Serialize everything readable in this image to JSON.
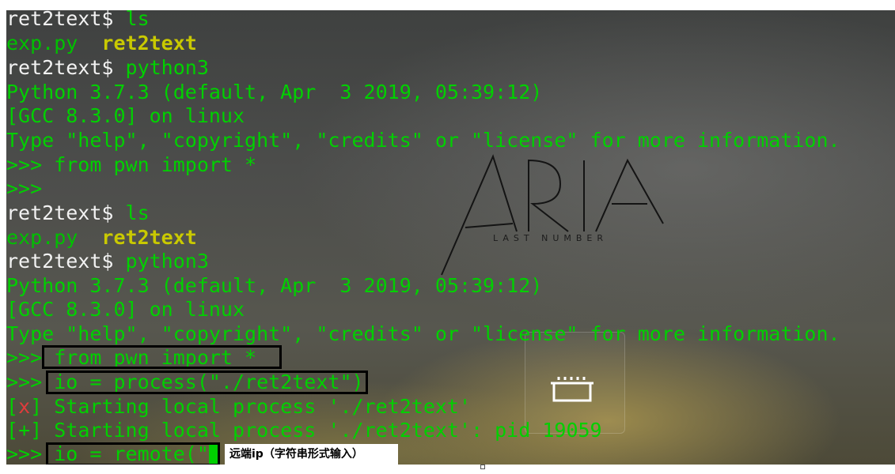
{
  "terminal": {
    "lines": [
      {
        "prompt": "ret2text$ ",
        "cmd": "ls"
      },
      {
        "col1": "exp.py",
        "col2": "ret2text"
      },
      {
        "prompt": "ret2text$ ",
        "cmd": "python3"
      },
      {
        "text": "Python 3.7.3 (default, Apr  3 2019, 05:39:12)"
      },
      {
        "text": "[GCC 8.3.0] on linux"
      },
      {
        "text": "Type \"help\", \"copyright\", \"credits\" or \"license\" for more information."
      },
      {
        "text": ">>> from pwn import *"
      },
      {
        "text": ">>>"
      },
      {
        "prompt": "ret2text$ ",
        "cmd": "ls"
      },
      {
        "col1": "exp.py",
        "col2": "ret2text"
      },
      {
        "prompt": "ret2text$ ",
        "cmd": "python3"
      },
      {
        "text": "Python 3.7.3 (default, Apr  3 2019, 05:39:12)"
      },
      {
        "text": "[GCC 8.3.0] on linux"
      },
      {
        "text": "Type \"help\", \"copyright\", \"credits\" or \"license\" for more information."
      },
      {
        "pyprompt": ">>> ",
        "code": "from pwn import *"
      },
      {
        "pyprompt": ">>> ",
        "code": "io = process(\"./ret2text\")"
      },
      {
        "open": "[",
        "mark": "x",
        "close": "] ",
        "msg": "Starting local process './ret2text'"
      },
      {
        "open": "[",
        "mark": "+",
        "close": "] ",
        "msg": "Starting local process './ret2text': pid 19059"
      },
      {
        "pyprompt": ">>> ",
        "code": "io = remote(\""
      }
    ]
  },
  "wallpaper": {
    "logo_text": "ARIA",
    "logo_subtext": "LAST NUMBER"
  },
  "annotation": {
    "caption": "远端ip（字符串形式输入）"
  },
  "colors": {
    "terminal_green": "#00d000",
    "prompt_white": "#f2f2f2",
    "filename_olive": "#c9c900",
    "error_red": "#e03c3c",
    "highlight_box": "#000000"
  }
}
